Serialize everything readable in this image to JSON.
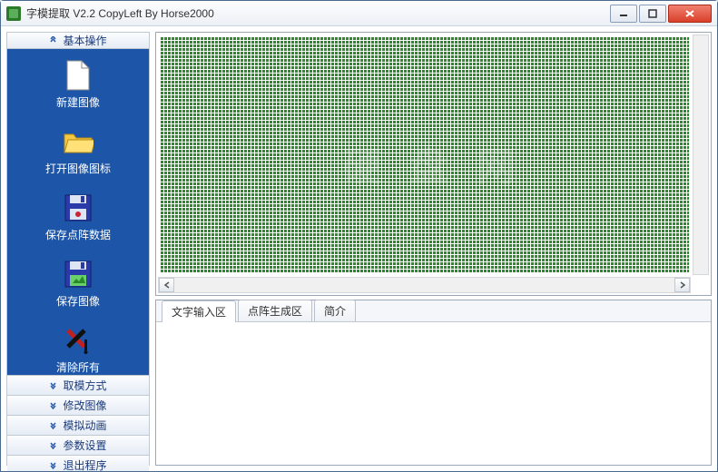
{
  "window": {
    "title": "字模提取  V2.2   CopyLeft By Horse2000"
  },
  "sidebar": {
    "header_expanded": "基本操作",
    "items": [
      {
        "label": "新建图像",
        "icon": "new-file-icon"
      },
      {
        "label": "打开图像图标",
        "icon": "open-folder-icon"
      },
      {
        "label": "保存点阵数据",
        "icon": "save-dotdata-icon"
      },
      {
        "label": "保存图像",
        "icon": "save-image-icon"
      },
      {
        "label": "清除所有",
        "icon": "clear-all-icon"
      }
    ],
    "collapsed": [
      {
        "label": "取模方式"
      },
      {
        "label": "修改图像"
      },
      {
        "label": "模拟动画"
      },
      {
        "label": "参数设置"
      },
      {
        "label": "退出程序"
      }
    ]
  },
  "canvas": {
    "watermark": "硬 盘 网"
  },
  "tabs": [
    {
      "label": "文字输入区",
      "active": true
    },
    {
      "label": "点阵生成区",
      "active": false
    },
    {
      "label": "简介",
      "active": false
    }
  ]
}
